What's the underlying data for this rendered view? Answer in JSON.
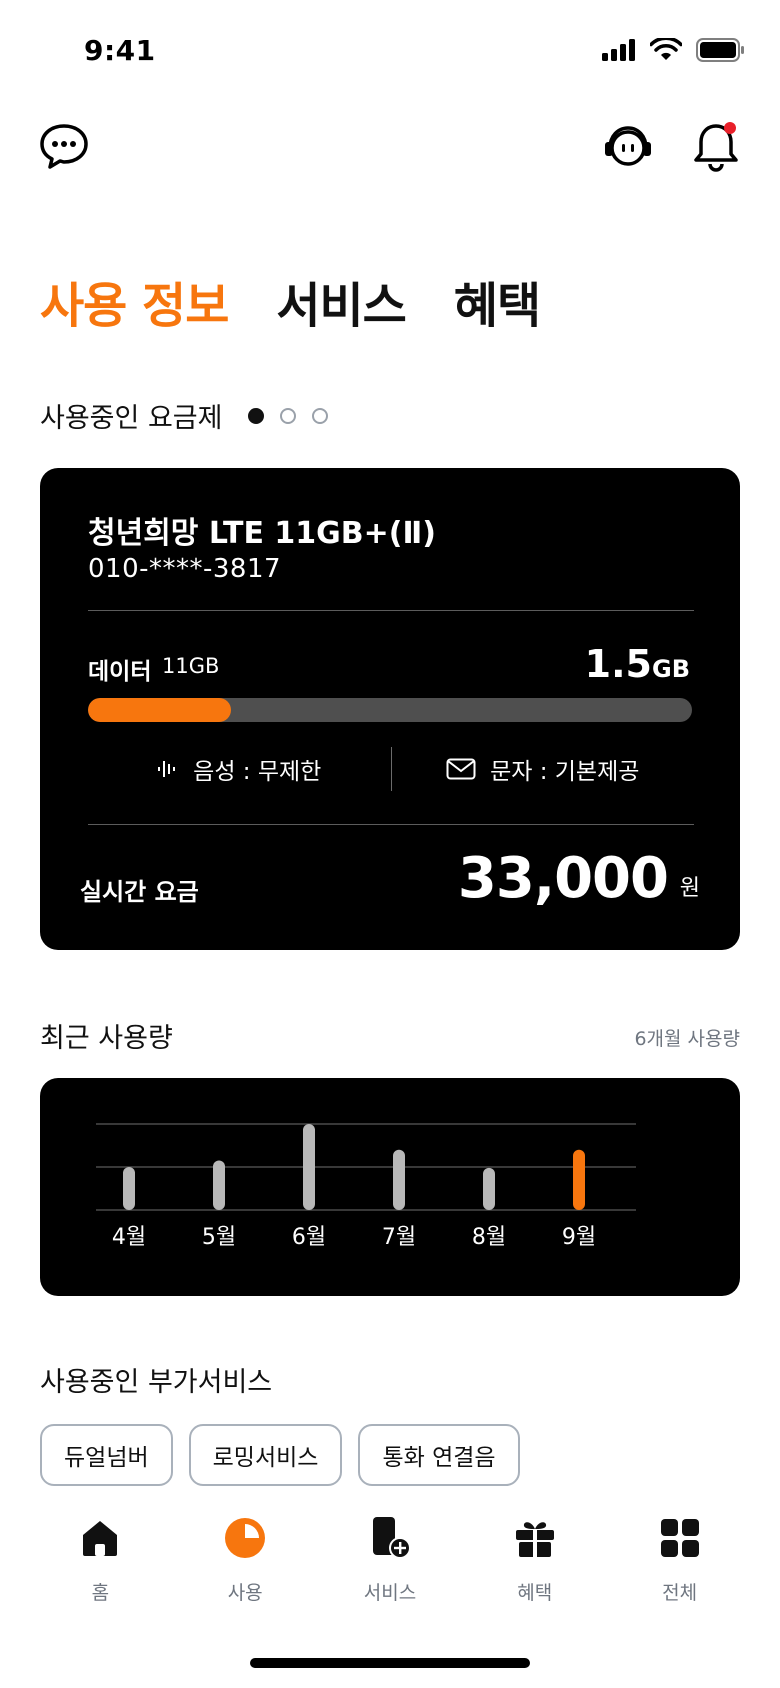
{
  "status_bar": {
    "time": "9:41"
  },
  "tabs": [
    {
      "label": "사용 정보",
      "active": true
    },
    {
      "label": "서비스",
      "active": false
    },
    {
      "label": "혜택",
      "active": false
    }
  ],
  "plan_section": {
    "title": "사용중인 요금제",
    "pages": 3,
    "current_page": 1
  },
  "plan": {
    "name": "청년희망 LTE 11GB+(Ⅱ)",
    "phone": "010-****-3817",
    "data_label": "데이터",
    "data_total": "11GB",
    "data_used_value": "1.5",
    "data_used_unit": "GB",
    "data_used_fraction": 0.236,
    "voice": "음성 : 무제한",
    "sms": "문자 : 기본제공",
    "realtime_label": "실시간 요금",
    "realtime_amount": "33,000",
    "realtime_unit": "원"
  },
  "usage_section": {
    "title": "최근 사용량",
    "link": "6개월 사용량"
  },
  "chart_data": {
    "type": "bar",
    "categories": [
      "4월",
      "5월",
      "6월",
      "7월",
      "8월",
      "9월"
    ],
    "values": [
      1.0,
      1.15,
      2.0,
      1.4,
      0.98,
      1.4
    ],
    "highlight_index": 5,
    "ylim": [
      0,
      2.0
    ],
    "grid": true,
    "colors": {
      "bar": "#B8B8B8",
      "highlight": "#F7760E",
      "grid": "#4a4a4a",
      "label": "#ffffff"
    }
  },
  "addon_section": {
    "title": "사용중인 부가서비스",
    "chips": [
      "듀얼넘버",
      "로밍서비스",
      "통화 연결음"
    ]
  },
  "bottom_nav": [
    {
      "label": "홈",
      "icon": "home-icon",
      "active": false
    },
    {
      "label": "사용",
      "icon": "usage-pie-icon",
      "active": true
    },
    {
      "label": "서비스",
      "icon": "phone-plus-icon",
      "active": false
    },
    {
      "label": "혜택",
      "icon": "gift-icon",
      "active": false
    },
    {
      "label": "전체",
      "icon": "grid-icon",
      "active": false
    }
  ],
  "colors": {
    "accent": "#F7760E",
    "card": "#000000",
    "notification_dot": "#E8202A"
  }
}
